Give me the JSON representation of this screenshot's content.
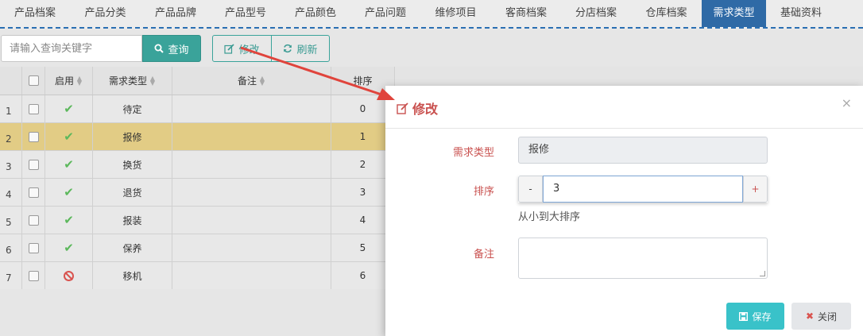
{
  "tabs": [
    {
      "label": "产品档案"
    },
    {
      "label": "产品分类"
    },
    {
      "label": "产品品牌"
    },
    {
      "label": "产品型号"
    },
    {
      "label": "产品颜色"
    },
    {
      "label": "产品问题"
    },
    {
      "label": "维修项目"
    },
    {
      "label": "客商档案"
    },
    {
      "label": "分店档案"
    },
    {
      "label": "仓库档案"
    },
    {
      "label": "需求类型",
      "active": true
    },
    {
      "label": "基础资料"
    }
  ],
  "toolbar": {
    "search_placeholder": "请输入查询关键字",
    "query_label": "查询",
    "edit_label": "修改",
    "refresh_label": "刷新"
  },
  "grid": {
    "headers": {
      "enabled": "启用",
      "type": "需求类型",
      "note": "备注",
      "sort": "排序"
    },
    "rows": [
      {
        "num": "1",
        "enabled": true,
        "type": "待定",
        "note": "",
        "sort": "0"
      },
      {
        "num": "2",
        "enabled": true,
        "type": "报修",
        "note": "",
        "sort": "1",
        "selected": true
      },
      {
        "num": "3",
        "enabled": true,
        "type": "换货",
        "note": "",
        "sort": "2"
      },
      {
        "num": "4",
        "enabled": true,
        "type": "退货",
        "note": "",
        "sort": "3"
      },
      {
        "num": "5",
        "enabled": true,
        "type": "报装",
        "note": "",
        "sort": "4"
      },
      {
        "num": "6",
        "enabled": true,
        "type": "保养",
        "note": "",
        "sort": "5"
      },
      {
        "num": "7",
        "enabled": false,
        "type": "移机",
        "note": "",
        "sort": "6"
      }
    ]
  },
  "dialog": {
    "title": "修改",
    "close": "×",
    "type_label": "需求类型",
    "type_value": "报修",
    "sort_label": "排序",
    "minus": "-",
    "plus": "+",
    "sort_value": "3",
    "sort_hint": "从小到大排序",
    "note_label": "备注",
    "note_value": "",
    "save_label": "保存",
    "cancel_label": "关闭"
  },
  "colors": {
    "accent": "#3aa39a",
    "active_tab": "#2f6aa6",
    "selected_row": "#e2cc85",
    "dialog_label": "#c9514f",
    "save": "#39c2c9",
    "arrow": "#e0443c"
  }
}
